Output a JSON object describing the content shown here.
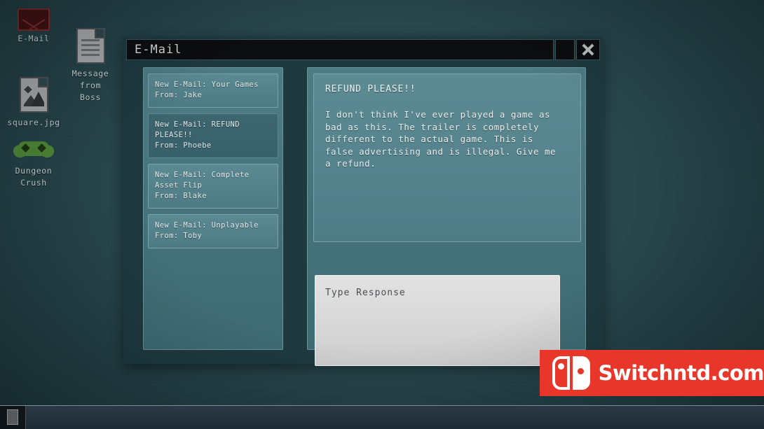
{
  "desktop": {
    "background_color": "#27454b",
    "icons": [
      {
        "id": "email",
        "label": "E-Mail",
        "icon": "envelope-icon"
      },
      {
        "id": "message-from-boss",
        "label": "Message\nfrom\nBoss",
        "label_lines": [
          "Message",
          "from",
          "Boss"
        ],
        "icon": "document-icon"
      },
      {
        "id": "square-jpg",
        "label": "square.jpg",
        "icon": "image-file-icon"
      },
      {
        "id": "dungeon-crush",
        "label": "Dungeon\nCrush",
        "label_lines": [
          "Dungeon",
          "Crush"
        ],
        "icon": "gamepad-icon"
      }
    ]
  },
  "window": {
    "title": "E-Mail",
    "close_label": "X",
    "blank_button_label": "",
    "frame_color": "#1e3a40",
    "titlebar_color": "#0c0d0e"
  },
  "mail_list": {
    "items": [
      {
        "subject": "New E-Mail: Your Games",
        "from": "From: Jake",
        "selected": false
      },
      {
        "subject": "New E-Mail: REFUND PLEASE!!",
        "from": "From: Phoebe",
        "selected": true
      },
      {
        "subject": "New E-Mail: Complete Asset Flip",
        "from": "From: Blake",
        "selected": false
      },
      {
        "subject": "New E-Mail: Unplayable",
        "from": "From: Toby",
        "selected": false
      }
    ]
  },
  "reader": {
    "subject": "REFUND PLEASE!!",
    "body": "I don't think I've ever played a game as bad as this. The trailer is completely different to the actual game. This is false advertising and is illegal. Give me a refund."
  },
  "response": {
    "placeholder": "Type Response",
    "value": ""
  },
  "taskbar": {
    "start_label": ""
  },
  "watermark": {
    "text": "Switchntd.com",
    "background_color": "#e8362a",
    "logo": "nintendo-switch-logo"
  }
}
